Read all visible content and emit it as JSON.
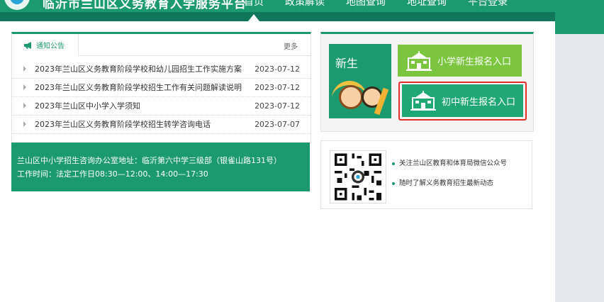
{
  "header": {
    "site_title": "临沂市兰山区义务教育入学服务平台",
    "nav": [
      "首页",
      "政策解读",
      "地图查询",
      "地址查询",
      "平台登录"
    ],
    "active_index": 0
  },
  "notice": {
    "tab_label": "通知公告",
    "more_label": "更多",
    "items": [
      {
        "title": "2023年兰山区义务教育阶段学校和幼儿园招生工作实施方案",
        "date": "2023-07-12"
      },
      {
        "title": "2023年兰山区义务教育阶段学校招生工作有关问题解读说明",
        "date": "2023-07-12"
      },
      {
        "title": "2023年兰山区中小学入学须知",
        "date": "2023-07-12"
      },
      {
        "title": "2023年兰山区义务教育阶段学校招生转学咨询电话",
        "date": "2023-07-07"
      }
    ]
  },
  "contact": {
    "address": "兰山区中小学招生咨询办公室地址：临沂第六中学三级部（银雀山路131号）",
    "hours": "工作时间：法定工作日08:30—12:00、14:00—17:30"
  },
  "enroll": {
    "new_label": "新生",
    "primary_button": "小学新生报名入口",
    "middle_button": "初中新生报名入口"
  },
  "qr": {
    "lines": [
      "关注兰山区教育和体育局微信公众号",
      "随时了解义务教育招生最新动态"
    ]
  },
  "colors": {
    "brand_green": "#1a9a6e",
    "light_green": "#7cc63f",
    "highlight_red": "#e0302a"
  }
}
